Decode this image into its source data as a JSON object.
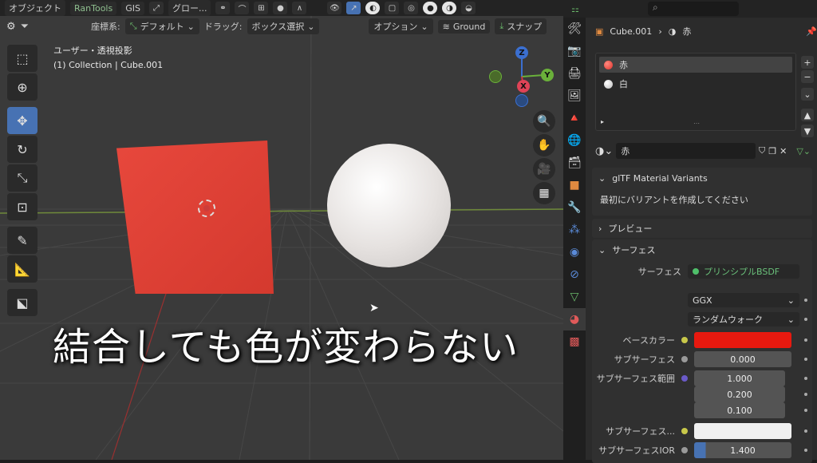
{
  "topbar": {
    "mode_label": "オブジェクト",
    "addon_menu": "RanTools",
    "gis_menu": "GIS",
    "transform_label": "グロー..."
  },
  "header2": {
    "coord_label": "座標系:",
    "coord_value": "デフォルト",
    "drag_label": "ドラッグ:",
    "drag_value": "ボックス選択",
    "options_label": "オプション",
    "ground_label": "Ground",
    "snap_label": "スナップ"
  },
  "viewport": {
    "view_name": "ユーザー・透視投影",
    "collection_info": "(1) Collection | Cube.001",
    "subtitle": "結合しても色が変わらない",
    "gizmo": {
      "z": "Z",
      "y": "Y",
      "x": "X"
    }
  },
  "properties": {
    "object_name": "Cube.001",
    "material_name": "赤",
    "slots": [
      {
        "name": "赤",
        "color": "#e0322a"
      },
      {
        "name": "白",
        "color": "#eeeeee"
      }
    ],
    "gltf_panel": "glTF Material Variants",
    "gltf_message": "最初にバリアントを作成してください",
    "preview_panel": "プレビュー",
    "surface_panel": "サーフェス",
    "surface_label": "サーフェス",
    "surface_value": "プリンシプルBSDF",
    "distribution": "GGX",
    "subsurface_method": "ランダムウォーク",
    "base_color_label": "ベースカラー",
    "base_color": "#e8190f",
    "subsurface_label": "サブサーフェス",
    "subsurface_value": "0.000",
    "subsurface_radius_label": "サブサーフェス範囲",
    "radius_values": [
      "1.000",
      "0.200",
      "0.100"
    ],
    "subsurface_color_label": "サブサーフェス...",
    "subsurface_color": "#f0f0f0",
    "subsurface_ior_label": "サブサーフェスIOR",
    "subsurface_ior_value": "1.400"
  }
}
